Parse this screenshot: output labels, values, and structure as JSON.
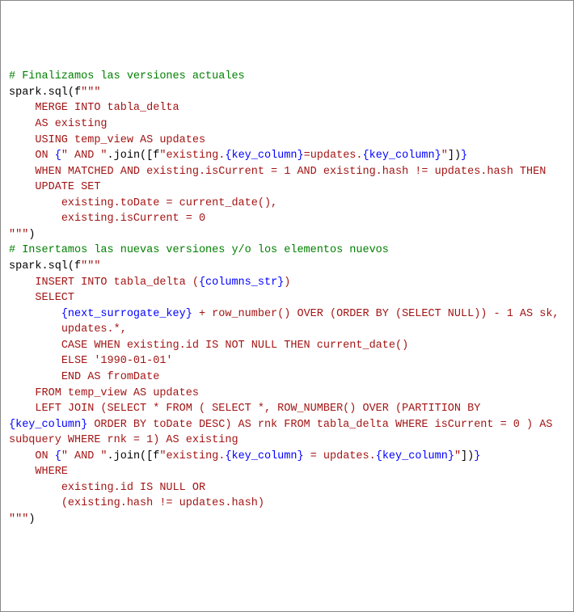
{
  "code": {
    "c1": "# Finalizamos las versiones actuales",
    "l2a": "spark.sql(f",
    "l2b": "\"\"\"",
    "l3": "    MERGE INTO tabla_delta ",
    "l4": "    AS existing",
    "l5": "    USING temp_view AS updates",
    "l6a": "    ON ",
    "l6b": "{",
    "l6c": "\" AND \"",
    "l6d": ".join([f",
    "l6e": "\"existing.",
    "l6f": "{key_column}",
    "l6g": "=updates.",
    "l6h": "{key_column}",
    "l6i": "\"",
    "l6j": "])",
    "l6k": "}",
    "l7": "    WHEN MATCHED AND existing.isCurrent = 1 AND existing.hash != updates.hash THEN",
    "l8": "    UPDATE SET",
    "l9": "        existing.toDate = current_date(),",
    "l10": "        existing.isCurrent = 0",
    "l11a": "\"\"\"",
    "l11b": ")",
    "blank": "",
    "c2": "# Insertamos las nuevas versiones y/o los elementos nuevos",
    "l13a": "spark.sql(f",
    "l13b": "\"\"\"",
    "l14a": "    INSERT INTO tabla_delta (",
    "l14b": "{columns_str}",
    "l14c": ")",
    "l15": "    SELECT ",
    "l16a": "        ",
    "l16b": "{next_surrogate_key}",
    "l16c": " + row_number() OVER (ORDER BY (SELECT NULL)) - 1 AS sk,",
    "l17": "        updates.*,",
    "l18": "        CASE WHEN existing.id IS NOT NULL THEN current_date() ",
    "l19": "        ELSE '1990-01-01' ",
    "l20": "        END AS fromDate",
    "l21": "    FROM temp_view AS updates",
    "l22a": "    LEFT JOIN (SELECT * FROM ( SELECT *, ROW_NUMBER() OVER (PARTITION BY ",
    "l22b": "{key_column}",
    "l22c": " ORDER BY toDate DESC) AS rnk FROM tabla_delta WHERE isCurrent = 0 ) AS subquery WHERE rnk = 1) AS existing",
    "l23a": "    ON ",
    "l23b": "{",
    "l23c": "\" AND \"",
    "l23d": ".join([f",
    "l23e": "\"existing.",
    "l23f": "{key_column}",
    "l23g": " = updates.",
    "l23h": "{key_column}",
    "l23i": "\"",
    "l23j": "])",
    "l23k": "}",
    "l24": "    WHERE ",
    "l25": "        existing.id IS NULL OR",
    "l26": "        (existing.hash != updates.hash)",
    "l27a": "\"\"\"",
    "l27b": ")"
  }
}
